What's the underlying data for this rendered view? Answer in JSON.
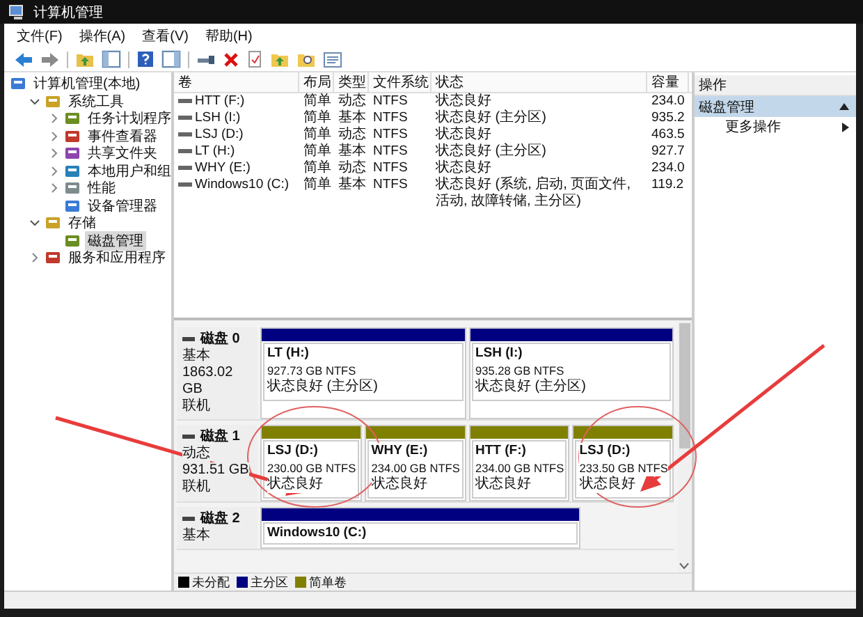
{
  "window": {
    "title": "计算机管理"
  },
  "menu": [
    {
      "label": "文件(F)"
    },
    {
      "label": "操作(A)"
    },
    {
      "label": "查看(V)"
    },
    {
      "label": "帮助(H)"
    }
  ],
  "tree": [
    {
      "label": "计算机管理(本地)",
      "selected": false,
      "children": [
        {
          "label": "系统工具",
          "expanded": true,
          "selected": false,
          "children": [
            {
              "label": "任务计划程序",
              "expanded": false,
              "selected": false
            },
            {
              "label": "事件查看器",
              "expanded": false,
              "selected": false
            },
            {
              "label": "共享文件夹",
              "expanded": false,
              "selected": false
            },
            {
              "label": "本地用户和组",
              "expanded": false,
              "selected": false
            },
            {
              "label": "性能",
              "expanded": false,
              "selected": false
            },
            {
              "label": "设备管理器",
              "selected": false
            }
          ]
        },
        {
          "label": "存储",
          "expanded": true,
          "selected": false,
          "children": [
            {
              "label": "磁盘管理",
              "selected": true
            }
          ]
        },
        {
          "label": "服务和应用程序",
          "expanded": false,
          "selected": false
        }
      ]
    }
  ],
  "volumes": {
    "columns": [
      "卷",
      "布局",
      "类型",
      "文件系统",
      "状态",
      "容量"
    ],
    "rows": [
      [
        "HTT (F:)",
        "简单",
        "动态",
        "NTFS",
        "状态良好",
        "234.0"
      ],
      [
        "LSH (I:)",
        "简单",
        "基本",
        "NTFS",
        "状态良好 (主分区)",
        "935.2"
      ],
      [
        "LSJ (D:)",
        "简单",
        "动态",
        "NTFS",
        "状态良好",
        "463.5"
      ],
      [
        "LT (H:)",
        "简单",
        "基本",
        "NTFS",
        "状态良好 (主分区)",
        "927.7"
      ],
      [
        "WHY (E:)",
        "简单",
        "动态",
        "NTFS",
        "状态良好",
        "234.0"
      ],
      [
        "Windows10 (C:)",
        "简单",
        "基本",
        "NTFS",
        "状态良好 (系统, 启动, 页面文件, 活动, 故障转储, 主分区)",
        "119.2"
      ]
    ]
  },
  "disks": [
    {
      "name": "磁盘 0",
      "type": "基本",
      "size": "1863.02 GB",
      "status": "联机",
      "partitions": [
        {
          "kind": "primary",
          "name": "LT  (H:)",
          "size": "927.73 GB NTFS",
          "status": "状态良好 (主分区)"
        },
        {
          "kind": "primary",
          "name": "LSH  (I:)",
          "size": "935.28 GB NTFS",
          "status": "状态良好 (主分区)"
        }
      ]
    },
    {
      "name": "磁盘 1",
      "type": "动态",
      "size": "931.51 GB",
      "status": "联机",
      "partitions": [
        {
          "kind": "simple",
          "name": "LSJ  (D:)",
          "size": "230.00 GB NTFS",
          "status": "状态良好"
        },
        {
          "kind": "simple",
          "name": "WHY  (E:)",
          "size": "234.00 GB NTFS",
          "status": "状态良好"
        },
        {
          "kind": "simple",
          "name": "HTT  (F:)",
          "size": "234.00 GB NTFS",
          "status": "状态良好"
        },
        {
          "kind": "simple",
          "name": "LSJ  (D:)",
          "size": "233.50 GB NTFS",
          "status": "状态良好"
        }
      ]
    },
    {
      "name": "磁盘 2",
      "type": "基本",
      "partitions": [
        {
          "kind": "primary",
          "name": "Windows10  (C:)"
        }
      ]
    }
  ],
  "legend": [
    {
      "label": "未分配",
      "color": "#000000"
    },
    {
      "label": "主分区",
      "color": "#000080"
    },
    {
      "label": "简单卷",
      "color": "#808000"
    }
  ],
  "actions": {
    "title": "操作",
    "section": {
      "label": "磁盘管理",
      "expanded": true
    },
    "items": [
      {
        "label": "更多操作"
      }
    ]
  }
}
